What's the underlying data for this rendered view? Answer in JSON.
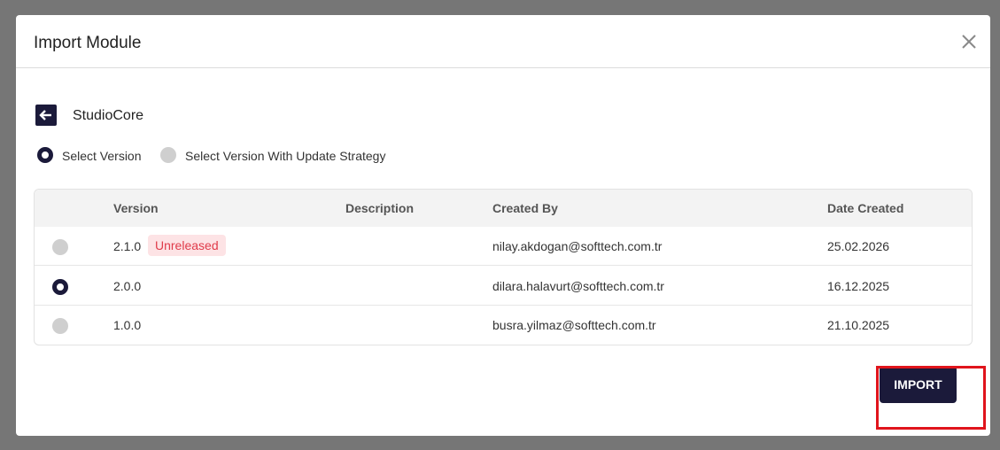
{
  "dialog": {
    "title": "Import Module",
    "close_icon": "close-icon"
  },
  "module": {
    "back_icon": "arrow-left-icon",
    "name": "StudioCore"
  },
  "version_mode": {
    "options": [
      {
        "label": "Select Version",
        "selected": true
      },
      {
        "label": "Select Version With Update Strategy",
        "selected": false
      }
    ]
  },
  "table": {
    "headers": {
      "version": "Version",
      "description": "Description",
      "created_by": "Created By",
      "date_created": "Date Created"
    },
    "rows": [
      {
        "version": "2.1.0",
        "badge": "Unreleased",
        "description": "",
        "created_by": "nilay.akdogan@softtech.com.tr",
        "date_created": "25.02.2026",
        "selected": false
      },
      {
        "version": "2.0.0",
        "badge": "",
        "description": "",
        "created_by": "dilara.halavurt@softtech.com.tr",
        "date_created": "16.12.2025",
        "selected": true
      },
      {
        "version": "1.0.0",
        "badge": "",
        "description": "",
        "created_by": "busra.yilmaz@softtech.com.tr",
        "date_created": "21.10.2025",
        "selected": false
      }
    ]
  },
  "footer": {
    "import_label": "IMPORT"
  },
  "colors": {
    "primary": "#1b1a3a",
    "badge_text": "#e03b4a",
    "badge_bg": "#fde3e5",
    "annotation_red": "#e0141c",
    "overlay": "#767676"
  }
}
